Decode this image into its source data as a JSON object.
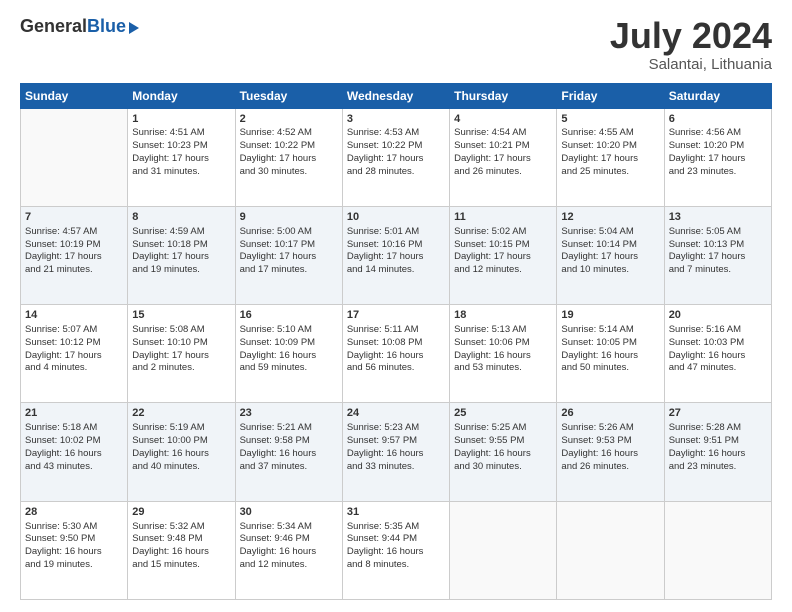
{
  "header": {
    "logo_general": "General",
    "logo_blue": "Blue",
    "month_title": "July 2024",
    "location": "Salantai, Lithuania"
  },
  "weekdays": [
    "Sunday",
    "Monday",
    "Tuesday",
    "Wednesday",
    "Thursday",
    "Friday",
    "Saturday"
  ],
  "weeks": [
    [
      {
        "num": "",
        "info": ""
      },
      {
        "num": "1",
        "info": "Sunrise: 4:51 AM\nSunset: 10:23 PM\nDaylight: 17 hours\nand 31 minutes."
      },
      {
        "num": "2",
        "info": "Sunrise: 4:52 AM\nSunset: 10:22 PM\nDaylight: 17 hours\nand 30 minutes."
      },
      {
        "num": "3",
        "info": "Sunrise: 4:53 AM\nSunset: 10:22 PM\nDaylight: 17 hours\nand 28 minutes."
      },
      {
        "num": "4",
        "info": "Sunrise: 4:54 AM\nSunset: 10:21 PM\nDaylight: 17 hours\nand 26 minutes."
      },
      {
        "num": "5",
        "info": "Sunrise: 4:55 AM\nSunset: 10:20 PM\nDaylight: 17 hours\nand 25 minutes."
      },
      {
        "num": "6",
        "info": "Sunrise: 4:56 AM\nSunset: 10:20 PM\nDaylight: 17 hours\nand 23 minutes."
      }
    ],
    [
      {
        "num": "7",
        "info": "Sunrise: 4:57 AM\nSunset: 10:19 PM\nDaylight: 17 hours\nand 21 minutes."
      },
      {
        "num": "8",
        "info": "Sunrise: 4:59 AM\nSunset: 10:18 PM\nDaylight: 17 hours\nand 19 minutes."
      },
      {
        "num": "9",
        "info": "Sunrise: 5:00 AM\nSunset: 10:17 PM\nDaylight: 17 hours\nand 17 minutes."
      },
      {
        "num": "10",
        "info": "Sunrise: 5:01 AM\nSunset: 10:16 PM\nDaylight: 17 hours\nand 14 minutes."
      },
      {
        "num": "11",
        "info": "Sunrise: 5:02 AM\nSunset: 10:15 PM\nDaylight: 17 hours\nand 12 minutes."
      },
      {
        "num": "12",
        "info": "Sunrise: 5:04 AM\nSunset: 10:14 PM\nDaylight: 17 hours\nand 10 minutes."
      },
      {
        "num": "13",
        "info": "Sunrise: 5:05 AM\nSunset: 10:13 PM\nDaylight: 17 hours\nand 7 minutes."
      }
    ],
    [
      {
        "num": "14",
        "info": "Sunrise: 5:07 AM\nSunset: 10:12 PM\nDaylight: 17 hours\nand 4 minutes."
      },
      {
        "num": "15",
        "info": "Sunrise: 5:08 AM\nSunset: 10:10 PM\nDaylight: 17 hours\nand 2 minutes."
      },
      {
        "num": "16",
        "info": "Sunrise: 5:10 AM\nSunset: 10:09 PM\nDaylight: 16 hours\nand 59 minutes."
      },
      {
        "num": "17",
        "info": "Sunrise: 5:11 AM\nSunset: 10:08 PM\nDaylight: 16 hours\nand 56 minutes."
      },
      {
        "num": "18",
        "info": "Sunrise: 5:13 AM\nSunset: 10:06 PM\nDaylight: 16 hours\nand 53 minutes."
      },
      {
        "num": "19",
        "info": "Sunrise: 5:14 AM\nSunset: 10:05 PM\nDaylight: 16 hours\nand 50 minutes."
      },
      {
        "num": "20",
        "info": "Sunrise: 5:16 AM\nSunset: 10:03 PM\nDaylight: 16 hours\nand 47 minutes."
      }
    ],
    [
      {
        "num": "21",
        "info": "Sunrise: 5:18 AM\nSunset: 10:02 PM\nDaylight: 16 hours\nand 43 minutes."
      },
      {
        "num": "22",
        "info": "Sunrise: 5:19 AM\nSunset: 10:00 PM\nDaylight: 16 hours\nand 40 minutes."
      },
      {
        "num": "23",
        "info": "Sunrise: 5:21 AM\nSunset: 9:58 PM\nDaylight: 16 hours\nand 37 minutes."
      },
      {
        "num": "24",
        "info": "Sunrise: 5:23 AM\nSunset: 9:57 PM\nDaylight: 16 hours\nand 33 minutes."
      },
      {
        "num": "25",
        "info": "Sunrise: 5:25 AM\nSunset: 9:55 PM\nDaylight: 16 hours\nand 30 minutes."
      },
      {
        "num": "26",
        "info": "Sunrise: 5:26 AM\nSunset: 9:53 PM\nDaylight: 16 hours\nand 26 minutes."
      },
      {
        "num": "27",
        "info": "Sunrise: 5:28 AM\nSunset: 9:51 PM\nDaylight: 16 hours\nand 23 minutes."
      }
    ],
    [
      {
        "num": "28",
        "info": "Sunrise: 5:30 AM\nSunset: 9:50 PM\nDaylight: 16 hours\nand 19 minutes."
      },
      {
        "num": "29",
        "info": "Sunrise: 5:32 AM\nSunset: 9:48 PM\nDaylight: 16 hours\nand 15 minutes."
      },
      {
        "num": "30",
        "info": "Sunrise: 5:34 AM\nSunset: 9:46 PM\nDaylight: 16 hours\nand 12 minutes."
      },
      {
        "num": "31",
        "info": "Sunrise: 5:35 AM\nSunset: 9:44 PM\nDaylight: 16 hours\nand 8 minutes."
      },
      {
        "num": "",
        "info": ""
      },
      {
        "num": "",
        "info": ""
      },
      {
        "num": "",
        "info": ""
      }
    ]
  ]
}
